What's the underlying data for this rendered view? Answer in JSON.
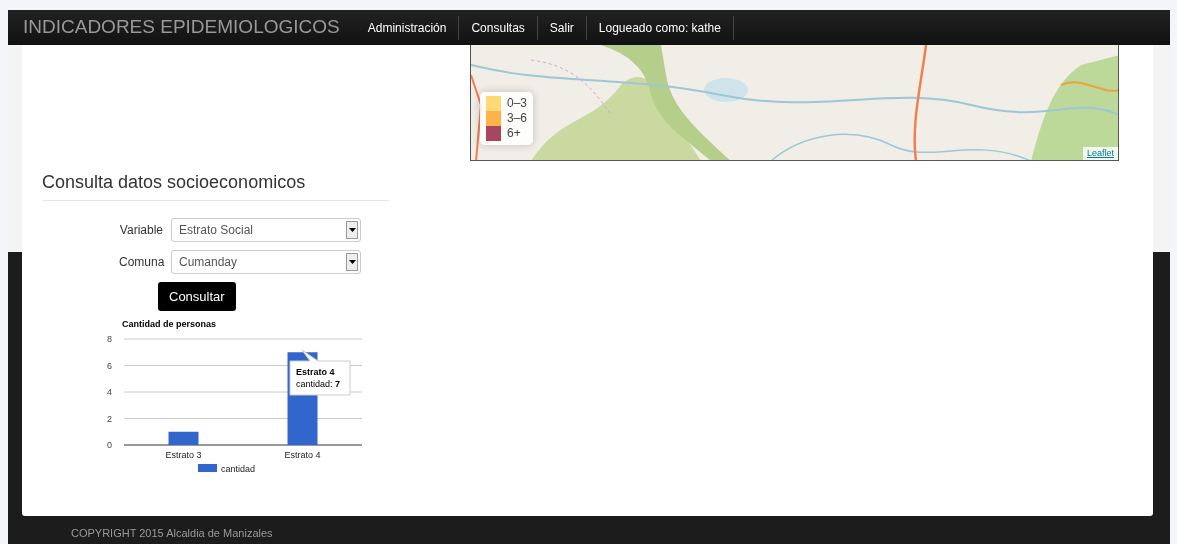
{
  "navbar": {
    "brand": "INDICADORES EPIDEMIOLOGICOS",
    "items": [
      {
        "label": "Administración"
      },
      {
        "label": "Consultas"
      },
      {
        "label": "Salir"
      },
      {
        "label": "Logueado como: kathe"
      }
    ]
  },
  "map": {
    "legend": [
      {
        "label": "0–3",
        "color": "#fed976"
      },
      {
        "label": "3–6",
        "color": "#feb24c"
      },
      {
        "label": "6+",
        "color": "#a8465f"
      }
    ],
    "attribution": "Leaflet"
  },
  "form": {
    "title": "Consulta datos socioeconomicos",
    "fields": [
      {
        "label": "Variable",
        "value": "Estrato Social"
      },
      {
        "label": "Comuna",
        "value": "Cumanday"
      }
    ],
    "button": "Consultar"
  },
  "chart": {
    "chart_data": {
      "type": "bar",
      "title": "Cantidad de personas",
      "categories": [
        "Estrato 3",
        "Estrato 4"
      ],
      "series": [
        {
          "name": "cantidad",
          "color": "#3366cc",
          "values": [
            1,
            7
          ]
        }
      ],
      "ylim": [
        0,
        8
      ],
      "grid": true,
      "yticks": [
        0,
        2,
        4,
        6,
        8
      ]
    },
    "tooltip": {
      "title": "Estrato 4",
      "label": "cantidad:",
      "value": "7"
    }
  },
  "footer": "COPYRIGHT 2015 Alcaldia de Manizales"
}
